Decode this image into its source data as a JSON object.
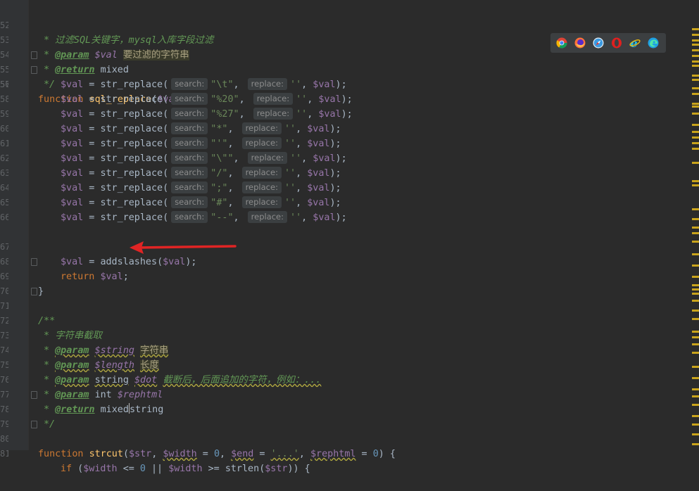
{
  "lines": [
    {
      "n": "52"
    },
    {
      "n": "53"
    },
    {
      "n": "54"
    },
    {
      "n": "55"
    },
    {
      "n": "56"
    },
    {
      "n": "57"
    },
    {
      "n": "58"
    },
    {
      "n": "59"
    },
    {
      "n": "60"
    },
    {
      "n": "61"
    },
    {
      "n": "62"
    },
    {
      "n": "63"
    },
    {
      "n": "64"
    },
    {
      "n": "65"
    },
    {
      "n": "66"
    },
    {
      "n": "67"
    },
    {
      "n": "68"
    },
    {
      "n": "69"
    },
    {
      "n": "70"
    },
    {
      "n": "71"
    },
    {
      "n": "72"
    },
    {
      "n": "73"
    },
    {
      "n": "74"
    },
    {
      "n": "75"
    },
    {
      "n": "76"
    },
    {
      "n": "77"
    },
    {
      "n": "78"
    },
    {
      "n": "79"
    },
    {
      "n": "80"
    },
    {
      "n": "81"
    }
  ],
  "code": {
    "c52": "* 过滤SQL关键字，mysql入库字段过滤",
    "c53_tag": "@param",
    "c53_var": "$val",
    "c53_desc": "要过滤的字符串",
    "c54_tag": "@return",
    "c54_type": "mixed",
    "c55": "*/",
    "fn_kw": "function",
    "fn_name": "sql_replace",
    "fn_param": "$val",
    "var": "$val",
    "call": "str_replace",
    "hint_search": "search:",
    "hint_replace": "replace:",
    "args": [
      "\"\\t\"",
      "\"%20\"",
      "\"%27\"",
      "\"*\"",
      "\"'\"",
      "\"\\\"\"",
      "\"/\"",
      "\";\"",
      "\"#\"",
      "\"--\""
    ],
    "empty": "''",
    "addslashes": "addslashes",
    "return_kw": "return",
    "close": "}",
    "c71": "/**",
    "c72": "* 字符串截取",
    "c73_var": "$string",
    "c73_desc": "字符串",
    "c74_var": "$length",
    "c74_desc": "长度",
    "c75_type": "string",
    "c75_var": "$dot",
    "c75_desc": "截断后，后面追加的字符，例如：...",
    "c76_type": "int",
    "c76_var": "$rephtml",
    "c77_type": "mixed",
    "c77_type2": "string",
    "fn2_name": "strcut",
    "fn2_p1": "$str",
    "fn2_p2": "$width",
    "fn2_p3": "$end",
    "fn2_p3_val": "'...'",
    "fn2_p4": "$rephtml",
    "num0": "0",
    "if_kw": "if",
    "strlen": "strlen",
    "op_le": "<=",
    "op_or": "||",
    "op_ge": ">="
  },
  "browsers": [
    "chrome-icon",
    "firefox-icon",
    "safari-icon",
    "opera-icon",
    "ie-icon",
    "edge-icon"
  ],
  "colors": {
    "bg": "#2b2b2b",
    "keyword": "#cc7832",
    "variable": "#9876aa",
    "function": "#ffc66d",
    "string": "#6a8759",
    "number": "#6897bb",
    "comment": "#629755",
    "arrow": "#e02424"
  }
}
